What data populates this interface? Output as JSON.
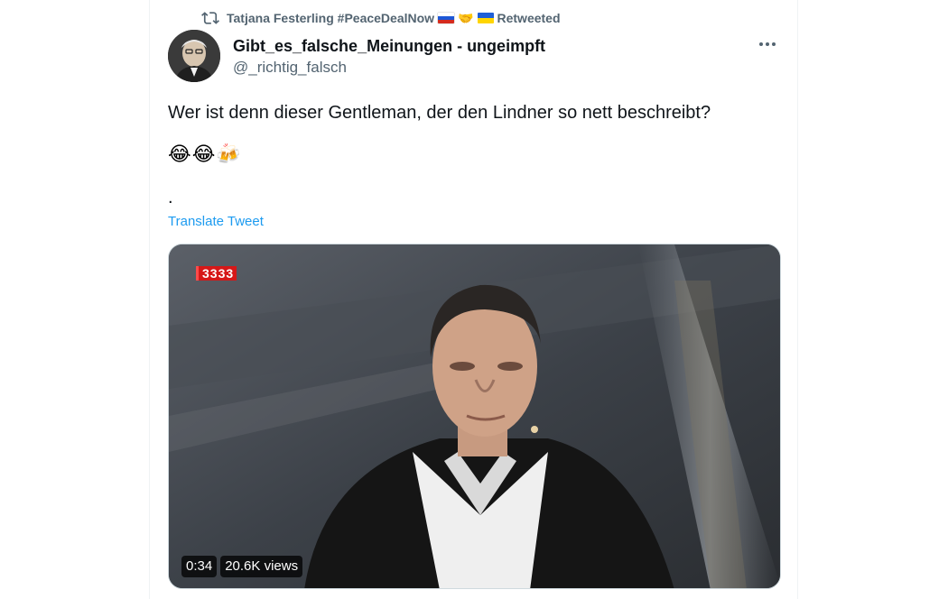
{
  "social_context": {
    "retweeter": "Tatjana Festerling #PeaceDealNow",
    "emoji_handshake": "🤝",
    "action": "Retweeted"
  },
  "author": {
    "display_name": "Gibt_es_falsche_Meinungen - ungeimpft",
    "handle": "@_richtig_falsch"
  },
  "tweet": {
    "text": "Wer ist denn dieser Gentleman, der den Lindner so nett beschreibt?",
    "emojis": "😂😂🍻",
    "dot": ".",
    "translate_label": "Translate Tweet"
  },
  "media": {
    "channel_badge": "3333",
    "duration": "0:34",
    "views": "20.6K views"
  },
  "colors": {
    "accent": "#1d9bf0",
    "secondary_text": "#536471",
    "primary_text": "#0f1419"
  }
}
